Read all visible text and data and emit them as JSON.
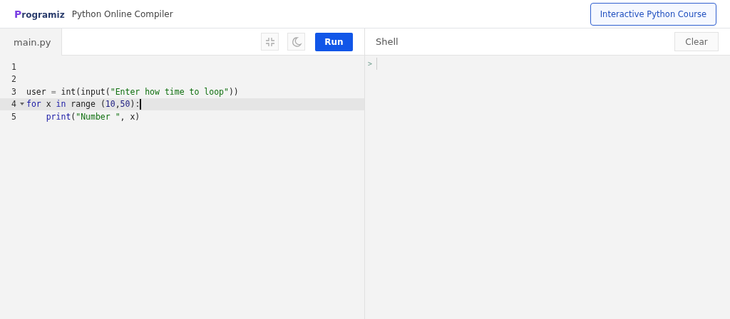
{
  "header": {
    "logo": "Programiz",
    "title": "Python Online Compiler",
    "course_button": "Interactive Python Course"
  },
  "editor": {
    "tab": {
      "label": "main.py",
      "selected": true
    },
    "run_button": "Run",
    "lines": [
      {
        "number": "1",
        "active": false,
        "foldable": false
      },
      {
        "number": "2",
        "active": false,
        "foldable": false
      },
      {
        "number": "3",
        "active": false,
        "foldable": false,
        "tokens": [
          {
            "text": "user ",
            "kind": "plain"
          },
          {
            "text": "=",
            "kind": "operator"
          },
          {
            "text": " int(input(",
            "kind": "plain"
          },
          {
            "text": "\"Enter how time to loop\"",
            "kind": "string"
          },
          {
            "text": "))",
            "kind": "plain"
          }
        ]
      },
      {
        "number": "4",
        "active": true,
        "foldable": true,
        "tokens": [
          {
            "text": "for",
            "kind": "keyword"
          },
          {
            "text": " x ",
            "kind": "plain"
          },
          {
            "text": "in",
            "kind": "keyword"
          },
          {
            "text": " range (",
            "kind": "plain"
          },
          {
            "text": "10",
            "kind": "number"
          },
          {
            "text": ",",
            "kind": "plain"
          },
          {
            "text": "50",
            "kind": "number"
          },
          {
            "text": "):",
            "kind": "plain"
          }
        ]
      },
      {
        "number": "5",
        "active": false,
        "foldable": false,
        "tokens": [
          {
            "text": "    print",
            "kind": "keyword"
          },
          {
            "text": "(",
            "kind": "plain"
          },
          {
            "text": "\"Number \"",
            "kind": "string"
          },
          {
            "text": ", x)",
            "kind": "plain"
          }
        ]
      }
    ]
  },
  "shell": {
    "title": "Shell",
    "clear_button": "Clear",
    "prompt": ">"
  }
}
